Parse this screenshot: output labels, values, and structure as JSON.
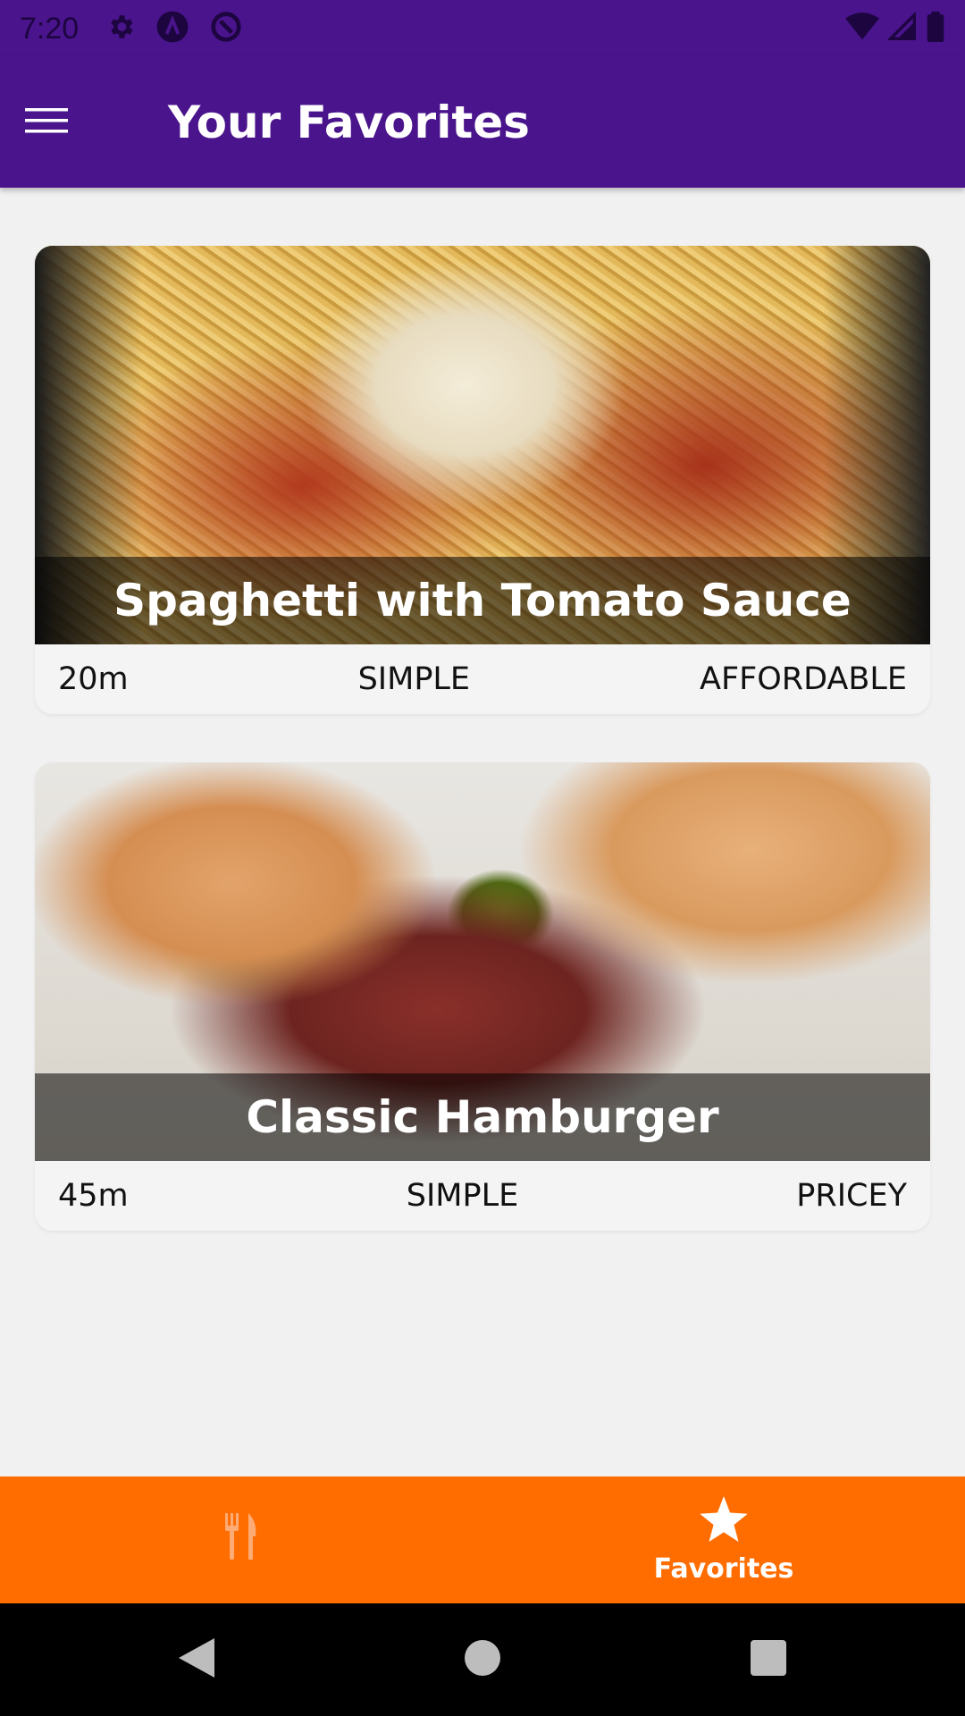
{
  "status_bar": {
    "time": "7:20",
    "left_icons": [
      "settings-icon",
      "app-a-icon",
      "sync-icon"
    ],
    "right_icons": [
      "wifi-icon",
      "signal-icon",
      "battery-icon"
    ]
  },
  "app_bar": {
    "title": "Your Favorites",
    "menu_icon": "hamburger-menu-icon"
  },
  "meals": [
    {
      "title": "Spaghetti with Tomato Sauce",
      "duration": "20m",
      "complexity": "SIMPLE",
      "affordability": "AFFORDABLE"
    },
    {
      "title": "Classic Hamburger",
      "duration": "45m",
      "complexity": "SIMPLE",
      "affordability": "PRICEY"
    }
  ],
  "bottom_nav": {
    "tabs": [
      {
        "icon": "restaurant-icon",
        "label": "",
        "active": false
      },
      {
        "icon": "star-icon",
        "label": "Favorites",
        "active": true
      }
    ]
  },
  "system_nav": {
    "buttons": [
      "back-icon",
      "home-icon",
      "recents-icon"
    ]
  },
  "colors": {
    "primary": "#4a148c",
    "accent": "#ff6d00",
    "background": "#f1f1f1"
  }
}
